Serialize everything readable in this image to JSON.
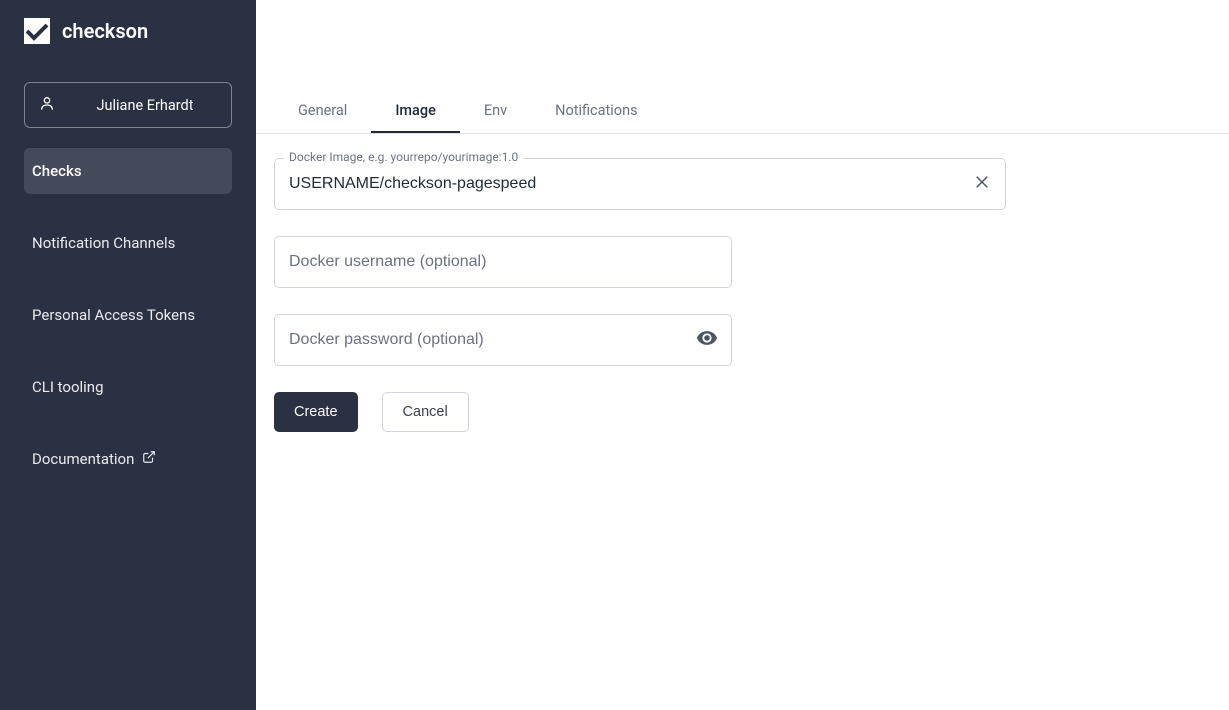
{
  "brand": {
    "name": "checkson"
  },
  "user": {
    "name": "Juliane Erhardt"
  },
  "sidebar": {
    "items": [
      {
        "label": "Checks",
        "active": true
      },
      {
        "label": "Notification Channels",
        "active": false
      },
      {
        "label": "Personal Access Tokens",
        "active": false
      },
      {
        "label": "CLI tooling",
        "active": false
      },
      {
        "label": "Documentation",
        "active": false,
        "external": true
      }
    ]
  },
  "tabs": [
    {
      "label": "General",
      "active": false
    },
    {
      "label": "Image",
      "active": true
    },
    {
      "label": "Env",
      "active": false
    },
    {
      "label": "Notifications",
      "active": false
    }
  ],
  "form": {
    "docker_image": {
      "label": "Docker Image, e.g. yourrepo/yourimage:1.0",
      "value": "USERNAME/checkson-pagespeed"
    },
    "docker_username": {
      "placeholder": "Docker username (optional)",
      "value": ""
    },
    "docker_password": {
      "placeholder": "Docker password (optional)",
      "value": ""
    }
  },
  "buttons": {
    "create": "Create",
    "cancel": "Cancel"
  }
}
